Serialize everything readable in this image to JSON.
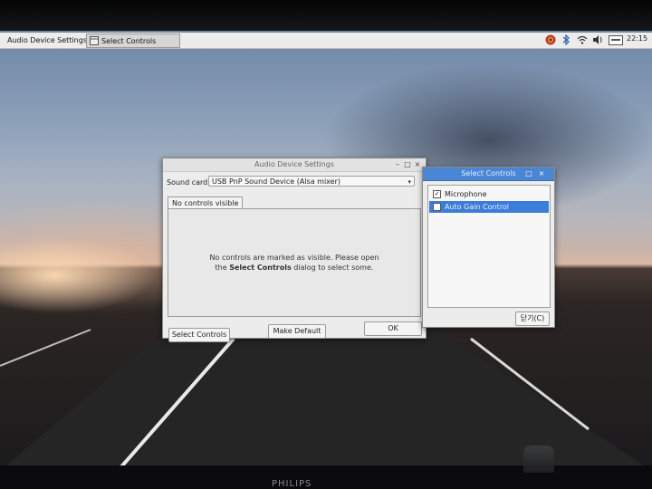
{
  "taskbar": {
    "tasks": [
      {
        "label": "Audio Device Settings",
        "icon": "audio-settings-icon"
      },
      {
        "label": "Select Controls",
        "icon": "window-icon"
      }
    ],
    "tray_icons": [
      "user-icon",
      "bluetooth-icon",
      "wifi-icon",
      "volume-icon",
      "keyboard-layout-icon"
    ],
    "clock": "22:15"
  },
  "audio_settings": {
    "title": "Audio Device Settings",
    "sound_card_label": "Sound card:",
    "sound_card_value": "USB PnP Sound Device (Alsa mixer)",
    "tab_label": "No controls visible",
    "message_line1": "No controls are marked as visible. Please open",
    "message_line2_prefix": "the ",
    "message_line2_bold": "Select Controls",
    "message_line2_suffix": " dialog to select some.",
    "buttons": {
      "select_controls": "Select Controls",
      "make_default": "Make Default",
      "ok": "OK"
    }
  },
  "select_controls": {
    "title": "Select Controls",
    "items": [
      {
        "label": "Microphone",
        "checked": true,
        "selected": false
      },
      {
        "label": "Auto Gain Control",
        "checked": false,
        "selected": true
      }
    ],
    "close_button": "닫기(C)"
  },
  "monitor": {
    "brand": "PHILIPS"
  },
  "colors": {
    "selection": "#3b7dd8",
    "titlebar_blue": "#4a86d6"
  }
}
